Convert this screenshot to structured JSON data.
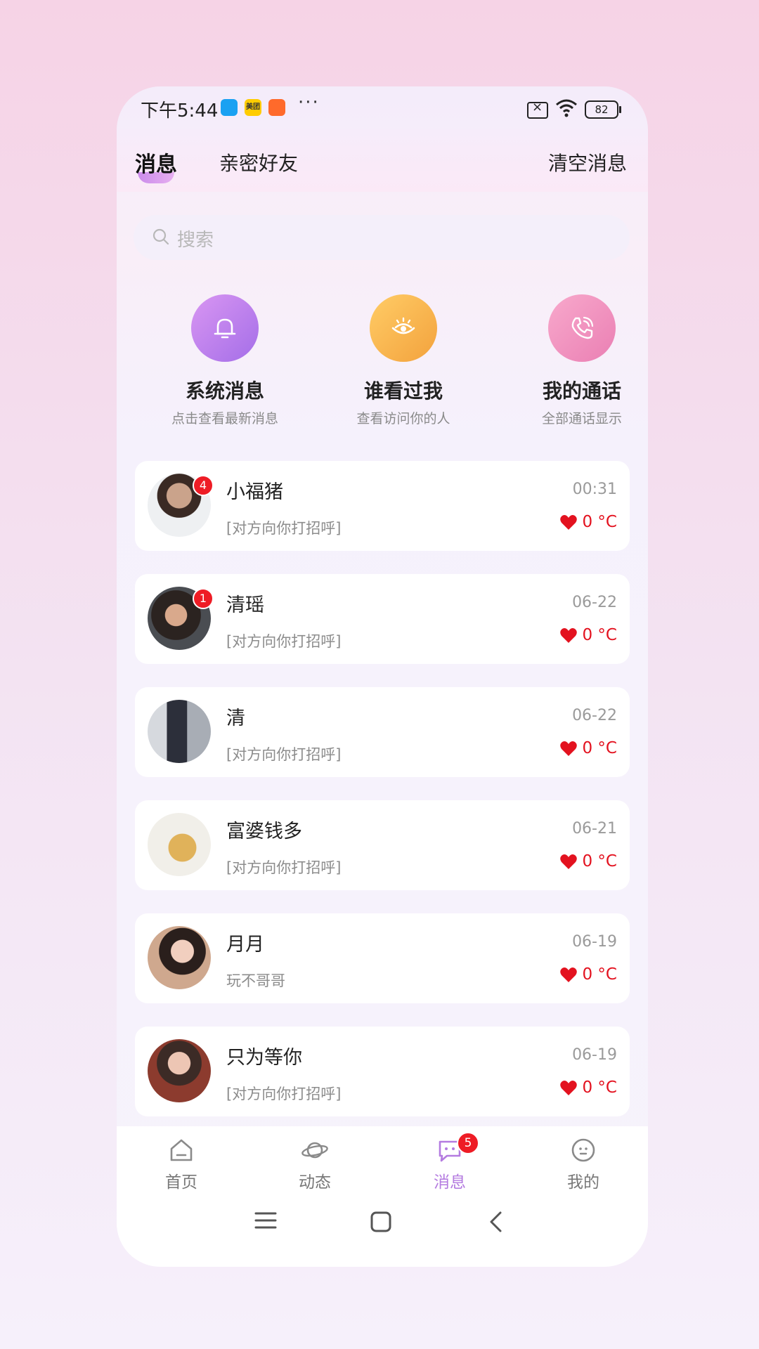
{
  "status_bar": {
    "time": "下午5:44",
    "app_badge_b": "美团",
    "dots": "···",
    "battery": "82"
  },
  "header": {
    "tab_messages": "消息",
    "tab_friends": "亲密好友",
    "clear_label": "清空消息"
  },
  "search": {
    "placeholder": "搜索"
  },
  "quick_entries": [
    {
      "title": "系统消息",
      "subtitle": "点击查看最新消息",
      "icon": "bell-icon",
      "color": "#b77ae9"
    },
    {
      "title": "谁看过我",
      "subtitle": "查看访问你的人",
      "icon": "eye-icon",
      "color": "#f6b54c"
    },
    {
      "title": "我的通话",
      "subtitle": "全部通话显示",
      "icon": "phone-icon",
      "color": "#ee8dbd"
    }
  ],
  "conversations": [
    {
      "name": "小福猪",
      "message": "[对方向你打招呼]",
      "date": "00:31",
      "heat": "0 °C",
      "unread": "4"
    },
    {
      "name": "清瑶",
      "message": "[对方向你打招呼]",
      "date": "06-22",
      "heat": "0 °C",
      "unread": "1"
    },
    {
      "name": "清",
      "message": "[对方向你打招呼]",
      "date": "06-22",
      "heat": "0 °C",
      "unread": ""
    },
    {
      "name": "富婆钱多",
      "message": "[对方向你打招呼]",
      "date": "06-21",
      "heat": "0 °C",
      "unread": ""
    },
    {
      "name": "月月",
      "message": "玩不哥哥",
      "date": "06-19",
      "heat": "0 °C",
      "unread": ""
    },
    {
      "name": "只为等你",
      "message": "[对方向你打招呼]",
      "date": "06-19",
      "heat": "0 °C",
      "unread": ""
    }
  ],
  "bottom_nav": [
    {
      "label": "首页",
      "icon": "home-icon"
    },
    {
      "label": "动态",
      "icon": "planet-icon"
    },
    {
      "label": "消息",
      "icon": "chat-icon",
      "badge": "5"
    },
    {
      "label": "我的",
      "icon": "face-icon"
    }
  ],
  "colors": {
    "accent": "#b47be0",
    "heart": "#e3121f",
    "badge": "#ee1c25"
  }
}
